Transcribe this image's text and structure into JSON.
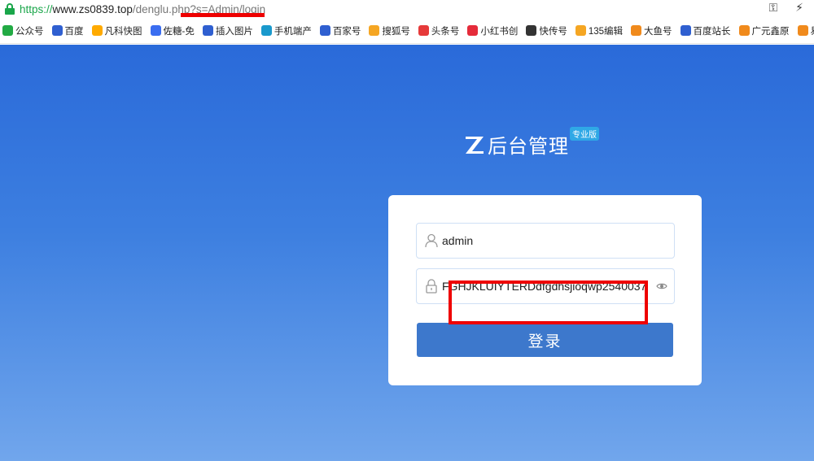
{
  "browser": {
    "url_scheme": "https://",
    "url_host": "www.zs0839.top",
    "url_path": "/denglu.php?s=Admin/login"
  },
  "bookmarks": [
    {
      "label": "公众号",
      "icon": "wechat-icon",
      "color": "#22aa44"
    },
    {
      "label": "百度",
      "icon": "baidu-paw-icon",
      "color": "#2f5fd0"
    },
    {
      "label": "凡科快图",
      "icon": "fanke-icon",
      "color": "#ffaa00"
    },
    {
      "label": "佐糖-免",
      "icon": "zuotang-icon",
      "color": "#3a6df0"
    },
    {
      "label": "插入图片",
      "icon": "baidu-paw-icon",
      "color": "#2f5fd0"
    },
    {
      "label": "手机端产",
      "icon": "phone-icon",
      "color": "#1a99cc"
    },
    {
      "label": "百家号",
      "icon": "baidu-paw-icon",
      "color": "#2f5fd0"
    },
    {
      "label": "搜狐号",
      "icon": "sohu-icon",
      "color": "#f5a623"
    },
    {
      "label": "头条号",
      "icon": "toutiao-icon",
      "color": "#e63a3a"
    },
    {
      "label": "小红书创",
      "icon": "xiaohongshu-icon",
      "color": "#e52b3a"
    },
    {
      "label": "快传号",
      "icon": "kuaichuan-icon",
      "color": "#333333"
    },
    {
      "label": "135编辑",
      "icon": "editor-135-icon",
      "color": "#f5a623"
    },
    {
      "label": "大鱼号",
      "icon": "dayu-icon",
      "color": "#f08a1c"
    },
    {
      "label": "百度站长",
      "icon": "baidu-paw-icon",
      "color": "#2f5fd0"
    },
    {
      "label": "广元鑫原",
      "icon": "e-icon",
      "color": "#f08a1c"
    },
    {
      "label": "易优",
      "icon": "yiyou-icon",
      "color": "#f08a1c"
    }
  ],
  "logo": {
    "title": "后台管理",
    "badge": "专业版"
  },
  "login": {
    "username_value": "admin",
    "password_value": "FGHJKLUIYTERDdfgdhsjioqwp2540037",
    "submit_label": "登录"
  },
  "colors": {
    "accent": "#3d78cc",
    "annotation": "#ee0000"
  }
}
